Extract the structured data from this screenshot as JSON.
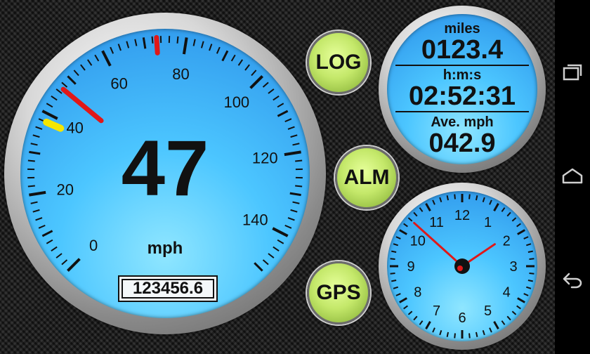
{
  "speedometer": {
    "speed": "47",
    "unit": "mph",
    "odometer": "123456.6",
    "scale_labels": [
      "0",
      "20",
      "40",
      "60",
      "80",
      "100",
      "120",
      "140"
    ],
    "scale_min": 0,
    "scale_max": 150,
    "max_speed_marker": 73,
    "yellow_marker": 38,
    "needle_value": 47
  },
  "buttons": {
    "log": "LOG",
    "alm": "ALM",
    "gps": "GPS"
  },
  "trip": {
    "distance_label": "miles",
    "distance_value": "0123.4",
    "time_label": "h:m:s",
    "time_value": "02:52:31",
    "avg_label": "Ave. mph",
    "avg_value": "042.9"
  },
  "clock": {
    "numbers": [
      "12",
      "1",
      "2",
      "3",
      "4",
      "5",
      "6",
      "7",
      "8",
      "9",
      "10",
      "11"
    ],
    "hour": 1,
    "minute": 52,
    "second": 0
  },
  "colors": {
    "needle": "#e01818",
    "marker_red": "#e01818",
    "marker_yellow": "#f5e600"
  },
  "navbar": {
    "icons": [
      "recent-apps-icon",
      "home-icon",
      "back-icon"
    ]
  }
}
